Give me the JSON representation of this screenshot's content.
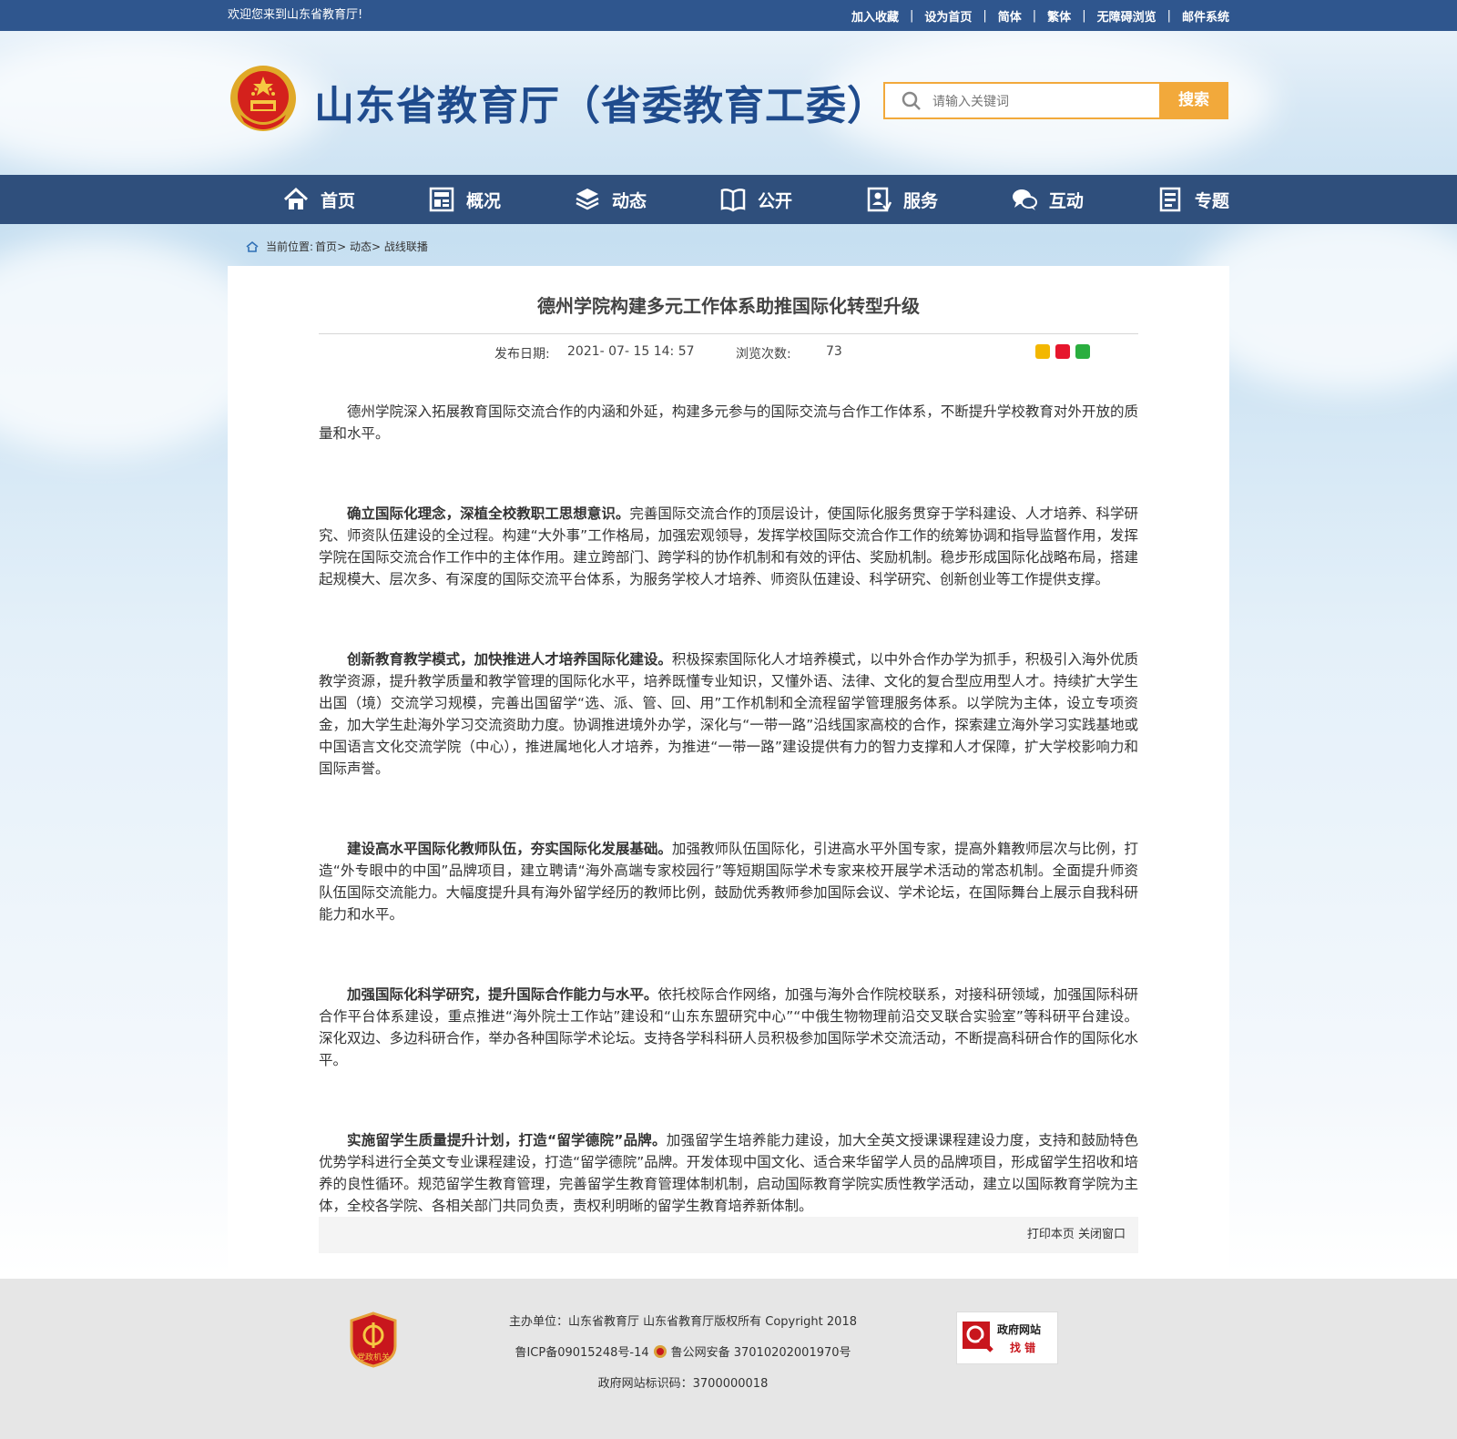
{
  "topbar": {
    "welcome": "欢迎您来到山东省教育厅!",
    "links": [
      "加入收藏",
      "设为首页",
      "简体",
      "繁体",
      "无障碍浏览",
      "邮件系统"
    ]
  },
  "header": {
    "site_title": "山东省教育厅（省委教育工委）",
    "search_placeholder": "请输入关键词",
    "search_button": "搜索"
  },
  "nav": {
    "items": [
      {
        "label": "首页",
        "icon": "home-icon"
      },
      {
        "label": "概况",
        "icon": "overview-icon"
      },
      {
        "label": "动态",
        "icon": "news-icon"
      },
      {
        "label": "公开",
        "icon": "book-icon"
      },
      {
        "label": "服务",
        "icon": "service-icon"
      },
      {
        "label": "互动",
        "icon": "chat-icon"
      },
      {
        "label": "专题",
        "icon": "topic-icon"
      }
    ]
  },
  "breadcrumb": {
    "label": "当前位置:",
    "items": [
      "首页",
      "动态",
      "战线联播"
    ]
  },
  "article": {
    "title": "德州学院构建多元工作体系助推国际化转型升级",
    "date_label": "发布日期:",
    "date": "2021- 07- 15 14: 57",
    "views_label": "浏览次数:",
    "views": "73",
    "paragraphs": [
      {
        "lead": "",
        "text": "德州学院深入拓展教育国际交流合作的内涵和外延，构建多元参与的国际交流与合作工作体系，不断提升学校教育对外开放的质量和水平。"
      },
      {
        "lead": "确立国际化理念，深植全校教职工思想意识。",
        "text": "完善国际交流合作的顶层设计，使国际化服务贯穿于学科建设、人才培养、科学研究、师资队伍建设的全过程。构建“大外事”工作格局，加强宏观领导，发挥学校国际交流合作工作的统筹协调和指导监督作用，发挥学院在国际交流合作工作中的主体作用。建立跨部门、跨学科的协作机制和有效的评估、奖励机制。稳步形成国际化战略布局，搭建起规模大、层次多、有深度的国际交流平台体系，为服务学校人才培养、师资队伍建设、科学研究、创新创业等工作提供支撑。"
      },
      {
        "lead": "创新教育教学模式，加快推进人才培养国际化建设。",
        "text": "积极探索国际化人才培养模式，以中外合作办学为抓手，积极引入海外优质教学资源，提升教学质量和教学管理的国际化水平，培养既懂专业知识，又懂外语、法律、文化的复合型应用型人才。持续扩大学生出国（境）交流学习规模，完善出国留学“选、派、管、回、用”工作机制和全流程留学管理服务体系。以学院为主体，设立专项资金，加大学生赴海外学习交流资助力度。协调推进境外办学，深化与“一带一路”沿线国家高校的合作，探索建立海外学习实践基地或中国语言文化交流学院（中心），推进属地化人才培养，为推进“一带一路”建设提供有力的智力支撑和人才保障，扩大学校影响力和国际声誉。"
      },
      {
        "lead": "建设高水平国际化教师队伍，夯实国际化发展基础。",
        "text": "加强教师队伍国际化，引进高水平外国专家，提高外籍教师层次与比例，打造“外专眼中的中国”品牌项目，建立聘请“海外高端专家校园行”等短期国际学术专家来校开展学术活动的常态机制。全面提升师资队伍国际交流能力。大幅度提升具有海外留学经历的教师比例，鼓励优秀教师参加国际会议、学术论坛，在国际舞台上展示自我科研能力和水平。"
      },
      {
        "lead": "加强国际化科学研究，提升国际合作能力与水平。",
        "text": "依托校际合作网络，加强与海外合作院校联系，对接科研领域，加强国际科研合作平台体系建设，重点推进“海外院士工作站”建设和“山东东盟研究中心”“中俄生物物理前沿交叉联合实验室”等科研平台建设。深化双边、多边科研合作，举办各种国际学术论坛。支持各学科科研人员积极参加国际学术交流活动，不断提高科研合作的国际化水平。"
      },
      {
        "lead": "实施留学生质量提升计划，打造“留学德院”品牌。",
        "text": "加强留学生培养能力建设，加大全英文授课课程建设力度，支持和鼓励特色优势学科进行全英文专业课程建设，打造“留学德院”品牌。开发体现中国文化、适合来华留学人员的品牌项目，形成留学生招收和培养的良性循环。规范留学生教育管理，完善留学生教育管理体制机制，启动国际教育学院实质性教学活动，建立以国际教育学院为主体，全校各学院、各相关部门共同负责，责权利明晰的留学生教育培养新体制。"
      }
    ],
    "share_icons": [
      "qzone-icon",
      "weibo-icon",
      "wechat-icon"
    ],
    "print_label": "打印本页",
    "close_label": "关闭窗口"
  },
  "footer": {
    "line1": "主办单位：山东省教育厅 山东省教育厅版权所有 Copyright 2018",
    "icp": "鲁ICP备09015248号-14",
    "police": "鲁公网安备 37010202001970号",
    "site_code": "政府网站标识码：3700000018",
    "badge_text": "党政机关",
    "find_error_line1": "政府网站",
    "find_error_line2": "找 错"
  },
  "colors": {
    "topbar": "#2f568e",
    "nav": "#2f4f7c",
    "accent": "#f2a93b",
    "title_blue": "#1f4b8d"
  }
}
